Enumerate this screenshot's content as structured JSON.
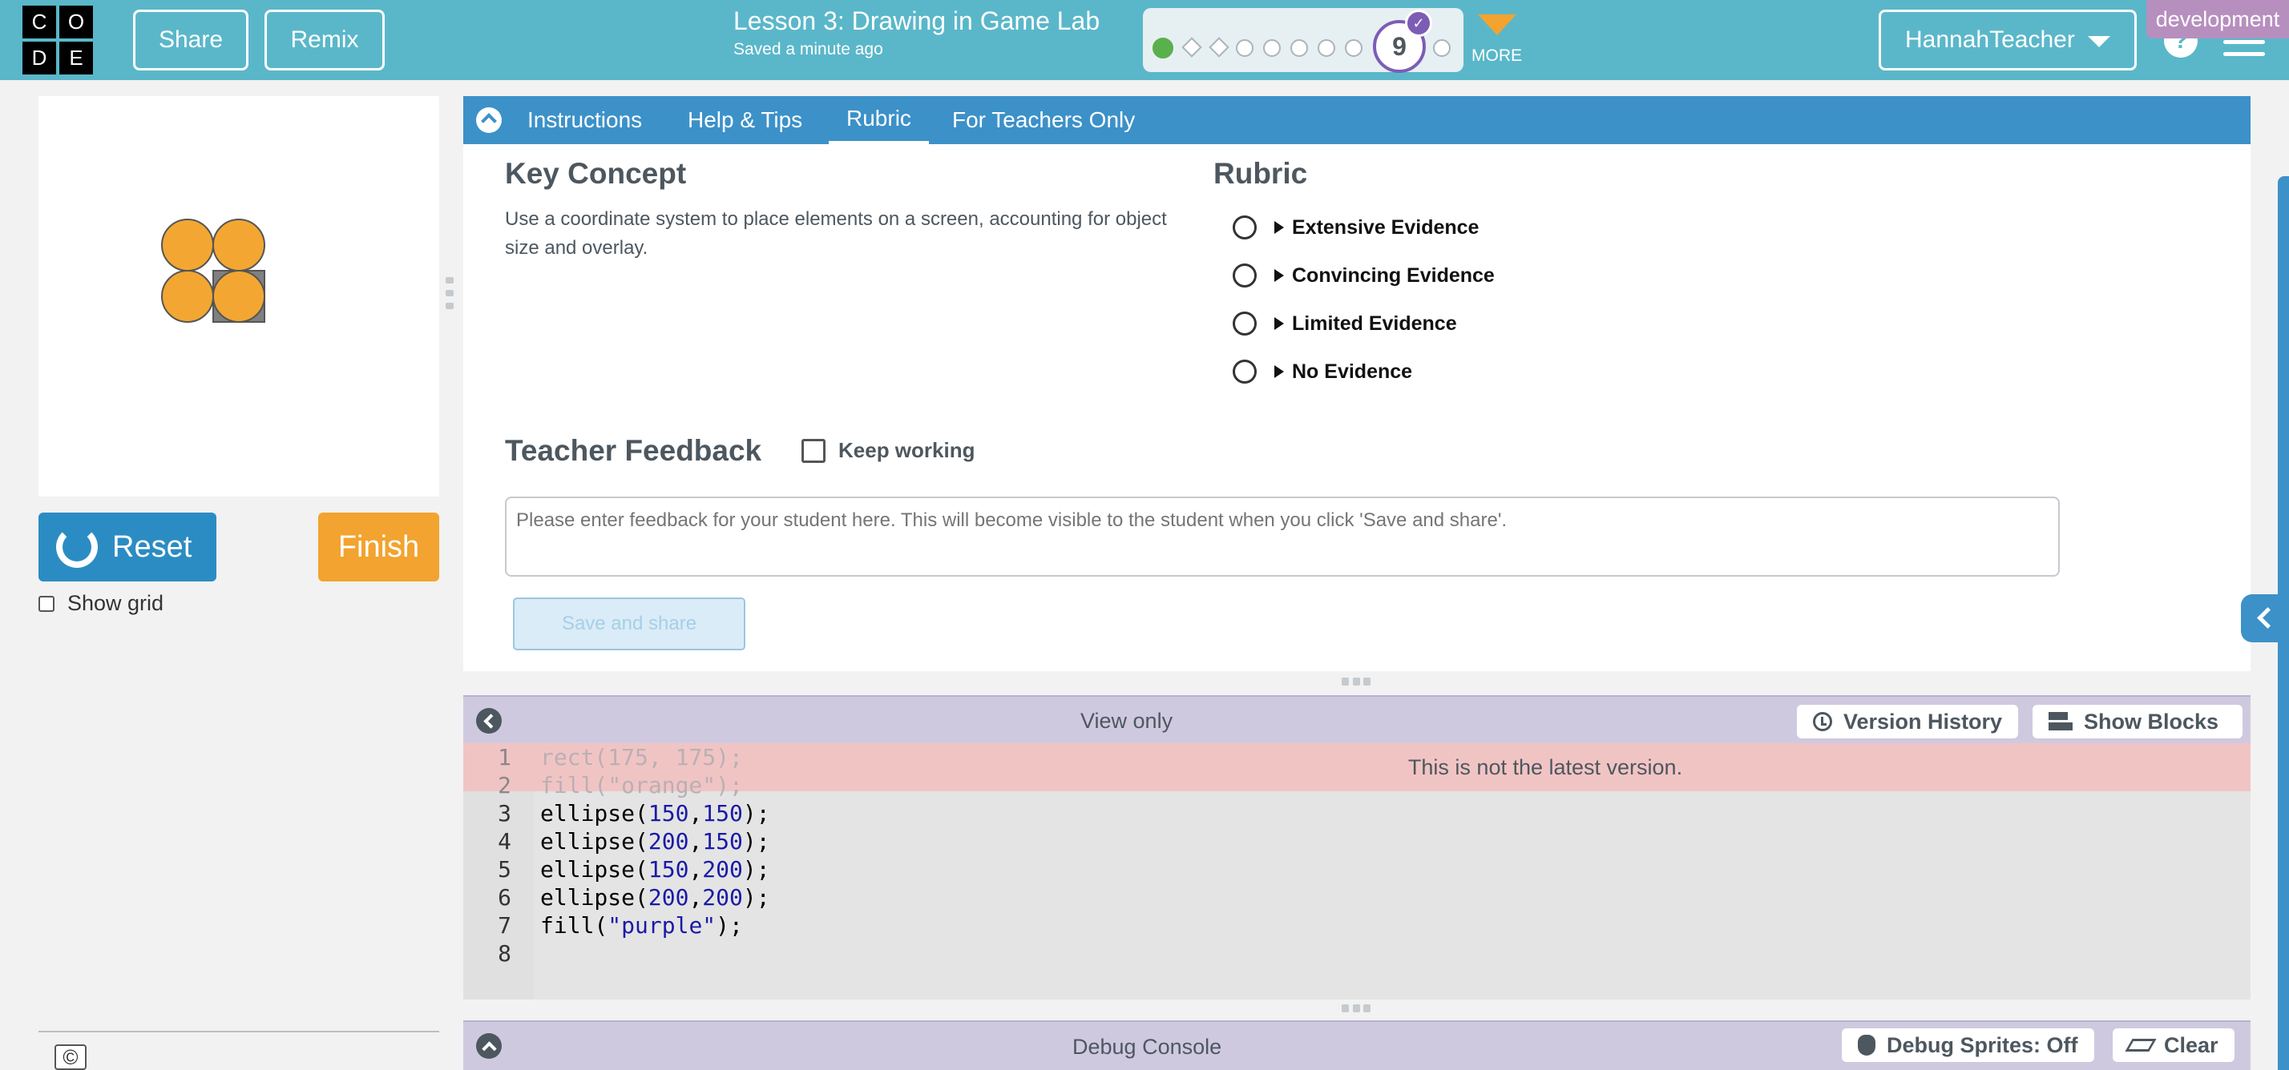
{
  "header": {
    "logo_letters": [
      "C",
      "O",
      "D",
      "E"
    ],
    "share_label": "Share",
    "remix_label": "Remix",
    "lesson_title": "Lesson 3: Drawing in Game Lab",
    "saved_status": "Saved a minute ago",
    "current_level": "9",
    "more_label": "MORE",
    "username": "HannahTeacher",
    "help_label": "?",
    "environment_badge": "development"
  },
  "progress": {
    "levels": [
      "complete",
      "assessment",
      "assessment",
      "not-tried",
      "not-tried",
      "not-tried",
      "not-tried",
      "not-tried",
      "current",
      "not-tried"
    ]
  },
  "visualization": {
    "reset_label": "Reset",
    "finish_label": "Finish",
    "show_grid_label": "Show grid",
    "copyright_label": "©",
    "shape_fill": "#f3a732",
    "rect_fill": "#808080"
  },
  "instructions": {
    "tabs": [
      "Instructions",
      "Help & Tips",
      "Rubric",
      "For Teachers Only"
    ],
    "active_tab": "Rubric",
    "key_concept_heading": "Key Concept",
    "key_concept_text": "Use a coordinate system to place elements on a screen, accounting for object size and overlay.",
    "rubric_heading": "Rubric",
    "rubric_options": [
      "Extensive Evidence",
      "Convincing Evidence",
      "Limited Evidence",
      "No Evidence"
    ],
    "feedback_heading": "Teacher Feedback",
    "keep_working_label": "Keep working",
    "feedback_placeholder": "Please enter feedback for your student here. This will become visible to the student when you click 'Save and share'.",
    "save_share_label": "Save and share"
  },
  "code_area": {
    "view_only_label": "View only",
    "version_history_label": "Version History",
    "show_blocks_label": "Show Blocks",
    "warning_text": "This is not the latest version.",
    "lines": [
      {
        "n": "1",
        "code": "rect(175, 175);"
      },
      {
        "n": "2",
        "code": "fill(\"orange\");"
      },
      {
        "n": "3",
        "code": "ellipse(150,150);"
      },
      {
        "n": "4",
        "code": "ellipse(200,150);"
      },
      {
        "n": "5",
        "code": "ellipse(150,200);"
      },
      {
        "n": "6",
        "code": "ellipse(200,200);"
      },
      {
        "n": "7",
        "code": "fill(\"purple\");"
      },
      {
        "n": "8",
        "code": ""
      }
    ]
  },
  "console": {
    "title": "Debug Console",
    "debug_sprites_label": "Debug Sprites: Off",
    "clear_label": "Clear"
  },
  "colors": {
    "header_bg": "#5ab7c9",
    "tab_bar_bg": "#3c91c9",
    "reset_bg": "#2b8cc4",
    "finish_bg": "#f3a32f",
    "code_header_bg": "#cfc9e0",
    "warning_bg": "#f3bebe"
  }
}
